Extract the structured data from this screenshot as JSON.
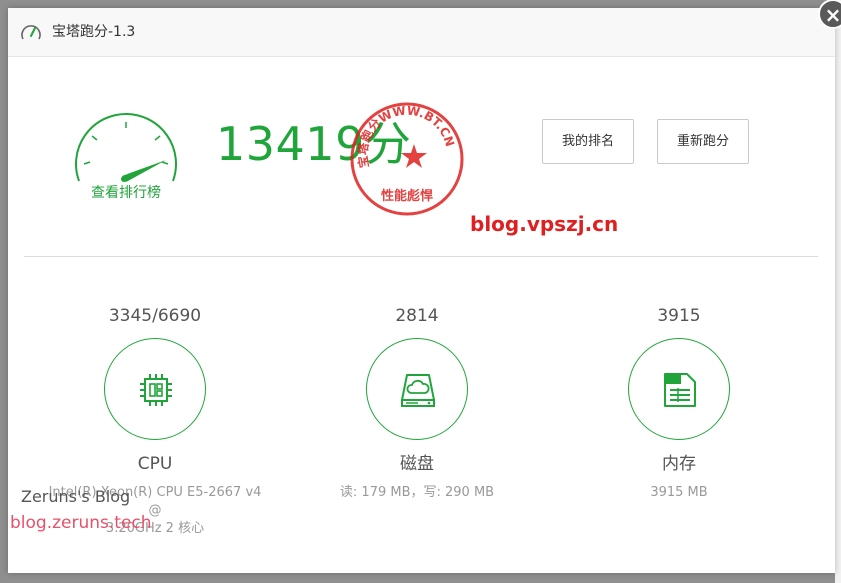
{
  "window": {
    "title": "宝塔跑分-1.3",
    "close_label": "×"
  },
  "benchmark": {
    "rank_link": "查看排行榜",
    "total_score": "13419分",
    "seal_outer_text": "宝塔跑分WWW.BT.CN",
    "seal_bottom_text": "性能彪悍",
    "buttons": {
      "my_rank": "我的排名",
      "retest": "重新跑分"
    }
  },
  "watermarks": {
    "top": "blog.vpszj.cn",
    "blog_name": "Zeruns's Blog",
    "blog_url": "blog.zeruns.tech"
  },
  "metrics": [
    {
      "score": "3345/6690",
      "name": "CPU",
      "detail_line1": "Intel(R) Xeon(R) CPU E5-2667 v4 @",
      "detail_line2": "3.20GHz 2 核心",
      "icon": "cpu-chip-icon"
    },
    {
      "score": "2814",
      "name": "磁盘",
      "detail_line1": "读: 179 MB，写: 290 MB",
      "icon": "disk-cloud-icon"
    },
    {
      "score": "3915",
      "name": "内存",
      "detail_line1": "3915 MB",
      "icon": "memory-card-icon"
    }
  ],
  "colors": {
    "accent_green": "#20a53a",
    "seal_red": "#e02020",
    "watermark_pink": "#e8506a"
  }
}
